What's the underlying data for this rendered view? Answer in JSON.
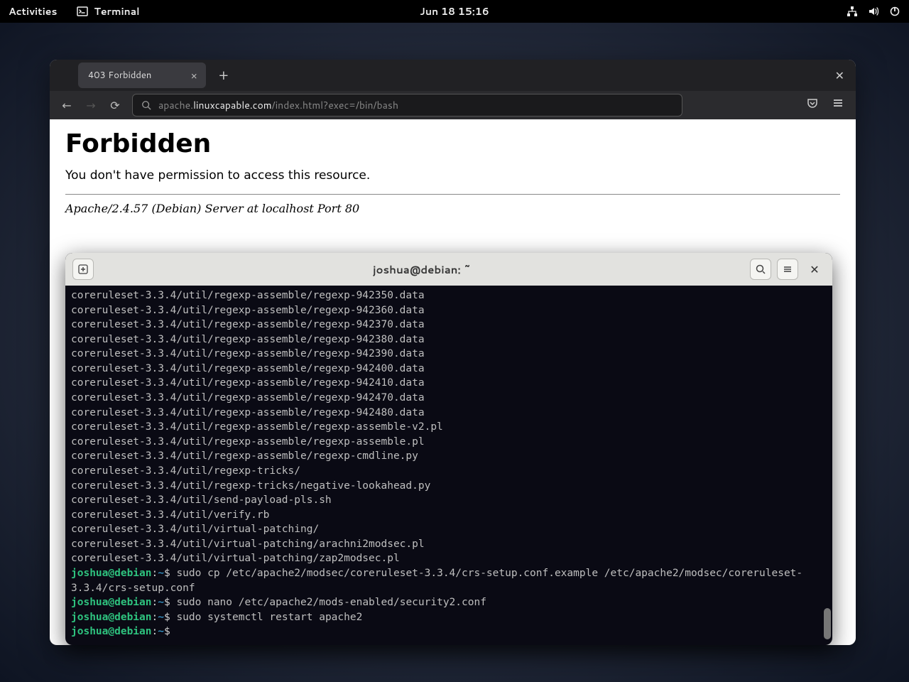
{
  "topbar": {
    "activities": "Activities",
    "terminal": "Terminal",
    "datetime": "Jun 18  15:16"
  },
  "browser": {
    "tab_title": "403 Forbidden",
    "url_pre": "apache.",
    "url_host": "linuxcapable.com",
    "url_rest": "/index.html?exec=/bin/bash",
    "page_heading": "Forbidden",
    "page_message": "You don't have permission to access this resource.",
    "server_sig": "Apache/2.4.57 (Debian) Server at localhost Port 80"
  },
  "terminal": {
    "title": "joshua@debian: ~",
    "output_lines": [
      "coreruleset-3.3.4/util/regexp-assemble/regexp-942350.data",
      "coreruleset-3.3.4/util/regexp-assemble/regexp-942360.data",
      "coreruleset-3.3.4/util/regexp-assemble/regexp-942370.data",
      "coreruleset-3.3.4/util/regexp-assemble/regexp-942380.data",
      "coreruleset-3.3.4/util/regexp-assemble/regexp-942390.data",
      "coreruleset-3.3.4/util/regexp-assemble/regexp-942400.data",
      "coreruleset-3.3.4/util/regexp-assemble/regexp-942410.data",
      "coreruleset-3.3.4/util/regexp-assemble/regexp-942470.data",
      "coreruleset-3.3.4/util/regexp-assemble/regexp-942480.data",
      "coreruleset-3.3.4/util/regexp-assemble/regexp-assemble-v2.pl",
      "coreruleset-3.3.4/util/regexp-assemble/regexp-assemble.pl",
      "coreruleset-3.3.4/util/regexp-assemble/regexp-cmdline.py",
      "coreruleset-3.3.4/util/regexp-tricks/",
      "coreruleset-3.3.4/util/regexp-tricks/negative-lookahead.py",
      "coreruleset-3.3.4/util/send-payload-pls.sh",
      "coreruleset-3.3.4/util/verify.rb",
      "coreruleset-3.3.4/util/virtual-patching/",
      "coreruleset-3.3.4/util/virtual-patching/arachni2modsec.pl",
      "coreruleset-3.3.4/util/virtual-patching/zap2modsec.pl"
    ],
    "prompt_user": "joshua@debian",
    "commands": [
      "sudo cp /etc/apache2/modsec/coreruleset-3.3.4/crs-setup.conf.example /etc/apache2/modsec/coreruleset-3.3.4/crs-setup.conf",
      "sudo nano /etc/apache2/mods-enabled/security2.conf",
      "sudo systemctl restart apache2",
      ""
    ],
    "wrap_width": 118
  }
}
